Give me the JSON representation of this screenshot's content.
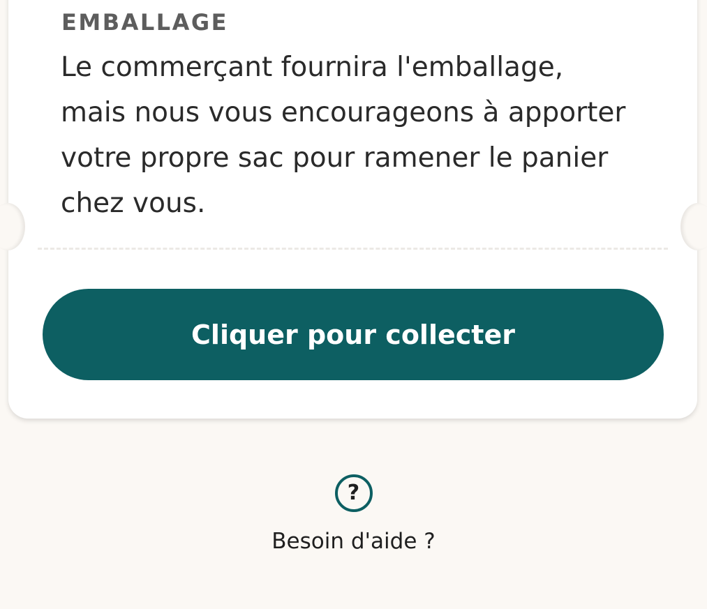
{
  "packaging": {
    "heading": "EMBALLAGE",
    "text": "Le commerçant fournira l'emballage, mais nous vous encourageons à apporter votre propre sac pour ramener le panier chez vous."
  },
  "collect_button": {
    "label": "Cliquer pour collecter"
  },
  "help": {
    "icon": "question-circle-icon",
    "icon_glyph": "?",
    "label": "Besoin d'aide ?"
  },
  "colors": {
    "accent": "#0d5f62",
    "background": "#fbf8f4",
    "card": "#ffffff"
  }
}
